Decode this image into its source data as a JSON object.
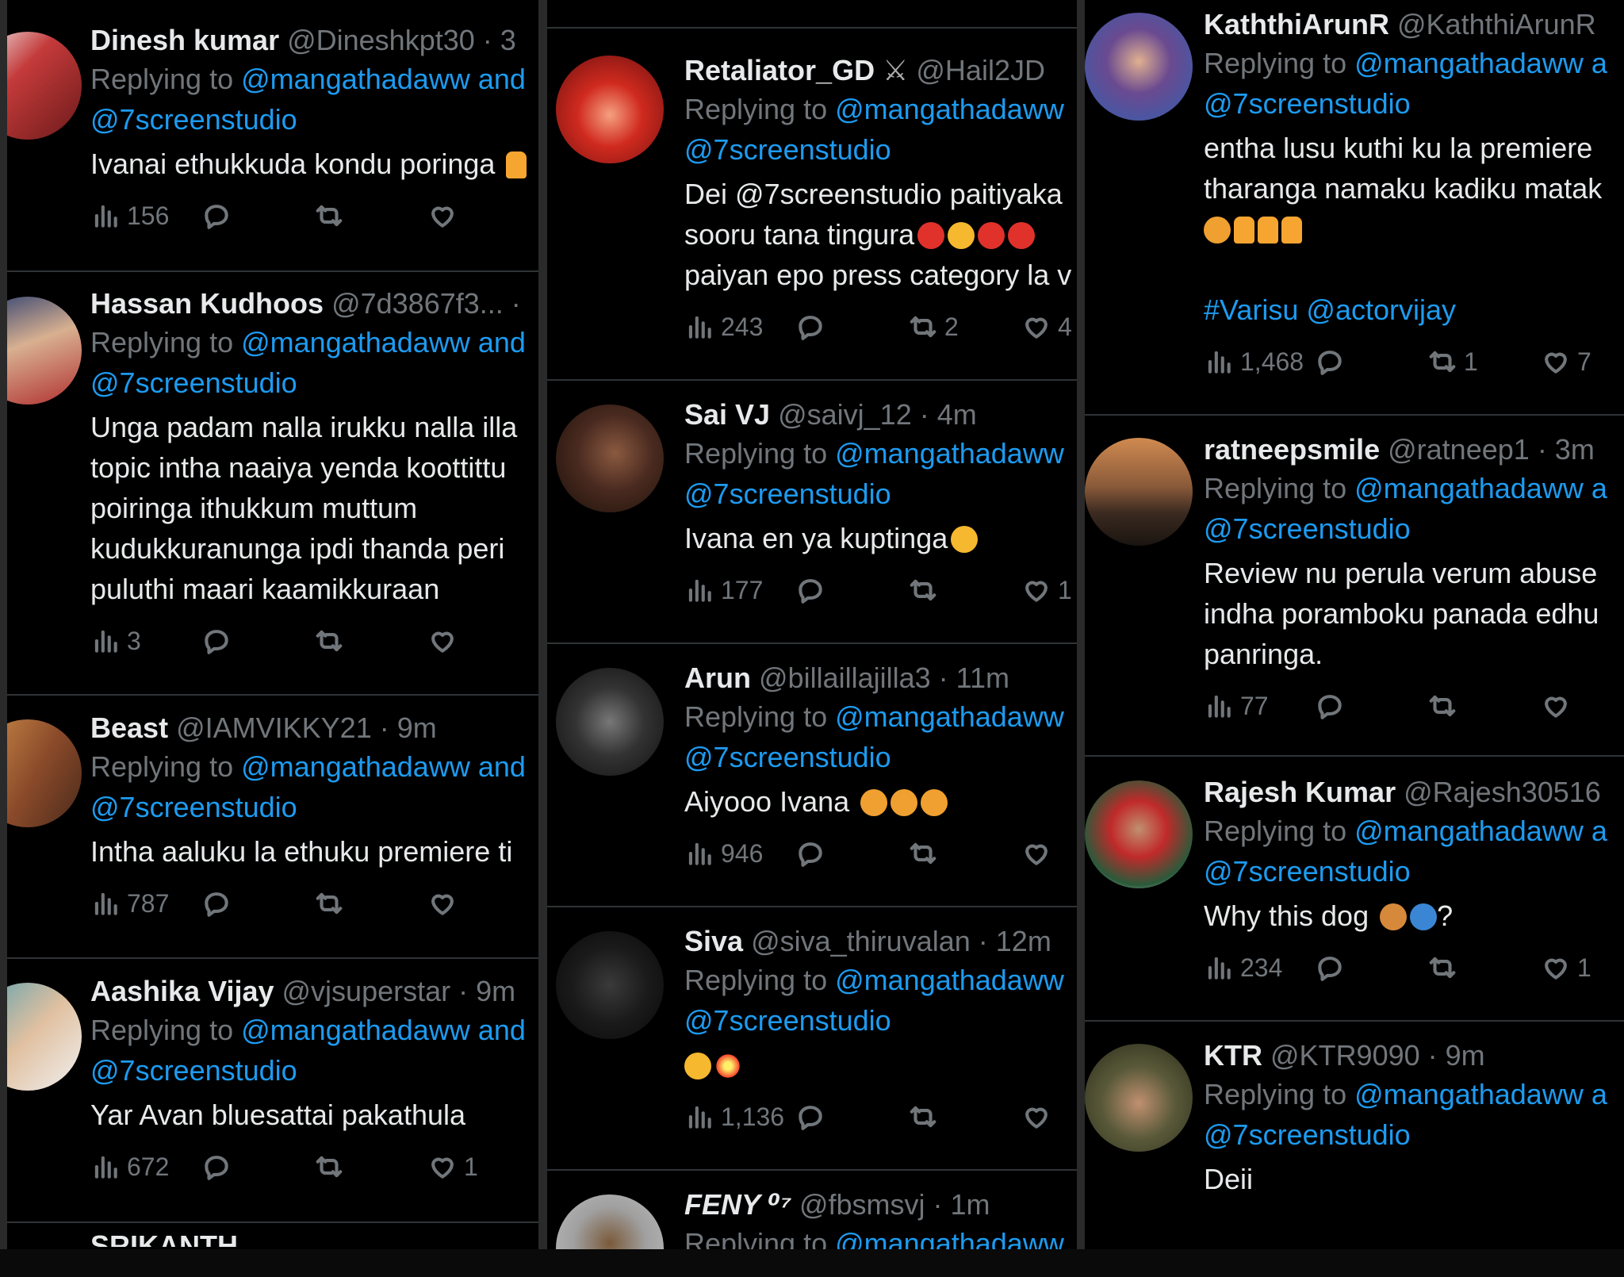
{
  "columns": [
    {
      "tweets": [
        {
          "name": "Dinesh kumar",
          "handle": "@Dineshkpt30",
          "time": "· 3",
          "replying_prefix": "Replying to",
          "replying_to": "@mangathadaww and",
          "replying_to2": "@7screenstudio",
          "text_lines": [
            "Ivanai ethukkuda kondu poringa"
          ],
          "views": "156",
          "replies": "",
          "retweets": "",
          "likes": "",
          "avatar_colors": [
            "#6b1a1a",
            "#c43a3a"
          ]
        },
        {
          "name": "Hassan Kudhoos",
          "handle": "@7d3867f3...",
          "time": "·",
          "replying_prefix": "Replying to",
          "replying_to": "@mangathadaww and",
          "replying_to2": "@7screenstudio",
          "text_lines": [
            "Unga padam nalla irukku nalla illa",
            "topic intha naaiya yenda koottittu",
            "poiringa ithukkum muttum",
            "kudukkuranunga ipdi thanda  peri",
            "puluthi maari kaamikkuraan"
          ],
          "views": "3",
          "replies": "",
          "retweets": "",
          "likes": "",
          "avatar_colors": [
            "#2a3d70",
            "#b03030"
          ]
        },
        {
          "name": "Beast",
          "handle": "@IAMVIKKY21",
          "time": "· 9m",
          "replying_prefix": "Replying to",
          "replying_to": "@mangathadaww and",
          "replying_to2": "@7screenstudio",
          "text_lines": [
            "Intha aaluku la ethuku premiere ti"
          ],
          "views": "787",
          "replies": "",
          "retweets": "",
          "likes": "",
          "avatar_colors": [
            "#8a4a2a",
            "#d0904a"
          ]
        },
        {
          "name": "Aashika Vijay",
          "handle": "@vjsuperstar",
          "time": "· 9m",
          "replying_prefix": "Replying to",
          "replying_to": "@mangathadaww and",
          "replying_to2": "@7screenstudio",
          "text_lines": [
            "Yar Avan bluesattai pakathula"
          ],
          "views": "672",
          "replies": "",
          "retweets": "",
          "likes": "1",
          "avatar_colors": [
            "#5aa0b0",
            "#e0c0a0"
          ]
        }
      ]
    },
    {
      "tweets": [
        {
          "name": "Retaliator_GD",
          "handle": "@Hail2JD",
          "time": "",
          "replying_prefix": "Replying to",
          "replying_to": "@mangathadaww",
          "replying_to2": "@7screenstudio",
          "text_lines": [
            "Dei @7screenstudio paitiyaka",
            "sooru tana tingura",
            "paiyan epo press category la v"
          ],
          "views": "243",
          "replies": "",
          "retweets": "2",
          "likes": "4",
          "avatar_colors": [
            "#d02a1e",
            "#f5a080"
          ]
        },
        {
          "name": "Sai VJ",
          "handle": "@saivj_12",
          "time": "· 4m",
          "replying_prefix": "Replying to",
          "replying_to": "@mangathadaww",
          "replying_to2": "@7screenstudio",
          "text_lines": [
            "Ivana en ya kuptinga"
          ],
          "views": "177",
          "replies": "",
          "retweets": "",
          "likes": "1",
          "avatar_colors": [
            "#2a1a14",
            "#8a5a40"
          ]
        },
        {
          "name": "Arun",
          "handle": "@billaillajilla3",
          "time": "· 11m",
          "replying_prefix": "Replying to",
          "replying_to": "@mangathadaww",
          "replying_to2": "@7screenstudio",
          "text_lines": [
            "Aiyooo Ivana"
          ],
          "views": "946",
          "replies": "",
          "retweets": "",
          "likes": "",
          "avatar_colors": [
            "#111111",
            "#777777"
          ]
        },
        {
          "name": "Siva",
          "handle": "@siva_thiruvalan",
          "time": "· 12m",
          "replying_prefix": "Replying to",
          "replying_to": "@mangathadaww",
          "replying_to2": "@7screenstudio",
          "text_lines": [
            ""
          ],
          "views": "1,136",
          "replies": "",
          "retweets": "",
          "likes": "",
          "avatar_colors": [
            "#0a0a0a",
            "#3a3a3a"
          ]
        },
        {
          "name": "FENY ⁰⁷",
          "handle": "@fbsmsvj",
          "time": "· 1m",
          "replying_prefix": "Replying to",
          "replying_to": "@mangathadaww",
          "replying_to2": "",
          "text_lines": [],
          "views": "",
          "replies": "",
          "retweets": "",
          "likes": "",
          "avatar_colors": [
            "#c0c0c0",
            "#7a5a3a"
          ]
        }
      ]
    },
    {
      "tweets": [
        {
          "name": "KaththiArunR",
          "handle": "@KaththiArunR",
          "time": "",
          "replying_prefix": "Replying to",
          "replying_to": "@mangathadaww a",
          "replying_to2": "@7screenstudio",
          "text_lines": [
            "entha lusu kuthi ku la premiere",
            "tharanga namaku kadiku matak",
            "",
            "",
            "#Varisu @actorvijay"
          ],
          "views": "1,468",
          "replies": "",
          "retweets": "1",
          "likes": "7",
          "avatar_colors": [
            "#3060b0",
            "#e0b090"
          ]
        },
        {
          "name": "ratneepsmile",
          "handle": "@ratneep1",
          "time": "· 3m",
          "replying_prefix": "Replying to",
          "replying_to": "@mangathadaww a",
          "replying_to2": "@7screenstudio",
          "text_lines": [
            "Review nu perula verum abuse",
            "indha poramboku panada edhu",
            "panringa."
          ],
          "views": "77",
          "replies": "",
          "retweets": "",
          "likes": "",
          "avatar_colors": [
            "#3a2a20",
            "#d08a50"
          ]
        },
        {
          "name": "Rajesh Kumar",
          "handle": "@Rajesh30516",
          "time": "",
          "replying_prefix": "Replying to",
          "replying_to": "@mangathadaww a",
          "replying_to2": "@7screenstudio",
          "text_lines": [
            "Why this dog"
          ],
          "views": "234",
          "replies": "",
          "retweets": "",
          "likes": "1",
          "avatar_colors": [
            "#2a5a3a",
            "#c02a2a"
          ]
        },
        {
          "name": "KTR",
          "handle": "@KTR9090",
          "time": "· 9m",
          "replying_prefix": "Replying to",
          "replying_to": "@mangathadaww a",
          "replying_to2": "@7screenstudio",
          "text_lines": [
            "Deii"
          ],
          "views": "",
          "replies": "",
          "retweets": "",
          "likes": "",
          "avatar_colors": [
            "#5a5a3a",
            "#c09070"
          ]
        }
      ]
    }
  ],
  "col1_cutoff_text": "SRIKANTH"
}
